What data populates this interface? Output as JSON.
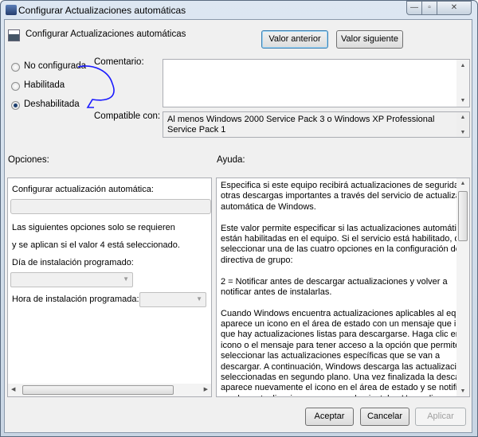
{
  "window": {
    "title": "Configurar Actualizaciones automáticas",
    "minimize": "—",
    "maximize": "▫",
    "close": "✕"
  },
  "header": {
    "policy_name": "Configurar Actualizaciones automáticas",
    "prev_button": "Valor anterior",
    "next_button": "Valor siguiente"
  },
  "state": {
    "options": [
      {
        "label": "No configurada",
        "selected": false
      },
      {
        "label": "Habilitada",
        "selected": false
      },
      {
        "label": "Deshabilitada",
        "selected": true
      }
    ]
  },
  "comment": {
    "label": "Comentario:",
    "value": ""
  },
  "compatible": {
    "label": "Compatible con:",
    "value": "Al menos Windows 2000 Service Pack 3 o Windows XP Professional Service Pack 1"
  },
  "options_panel": {
    "title": "Opciones:",
    "configure_label": "Configurar actualización automática:",
    "note_line1": "Las siguientes opciones solo se requieren",
    "note_line2": "y se aplican si el valor 4 está seleccionado.",
    "day_label": "Día de instalación programado:",
    "day_value": "",
    "time_label": "Hora de instalación programada:",
    "time_value": ""
  },
  "help_panel": {
    "title": "Ayuda:",
    "lines": [
      "Especifica si este equipo recibirá actualizaciones de seguridad y",
      "otras descargas importantes a través del servicio de actualización",
      "automática de Windows.",
      "",
      "Este valor permite especificar si las actualizaciones automáticas",
      "están habilitadas en el equipo. Si el servicio está habilitado, debe",
      "seleccionar una de las cuatro opciones en la configuración de",
      "directiva de grupo:",
      "",
      "2 = Notificar antes de descargar actualizaciones y volver a",
      "notificar antes de instalarlas.",
      "",
      "Cuando Windows encuentra actualizaciones aplicables al equipo,",
      "aparece un icono en el área de estado con un mensaje que indica",
      "que hay actualizaciones listas para descargarse. Haga clic en el",
      "icono o el mensaje para tener acceso a la opción que permite",
      "seleccionar las actualizaciones específicas que se van a",
      "descargar. A continuación, Windows descarga las actualizaciones",
      "seleccionadas en segundo plano. Una vez finalizada la descarga,",
      "aparece nuevamente el icono en el área de estado y se notifica",
      "que las actualizaciones ya se pueden instalar. Haga clic en el"
    ]
  },
  "footer": {
    "ok": "Aceptar",
    "cancel": "Cancelar",
    "apply": "Aplicar"
  },
  "colors": {
    "annotation": "#1a1aff",
    "accent": "#3c7fb1"
  }
}
